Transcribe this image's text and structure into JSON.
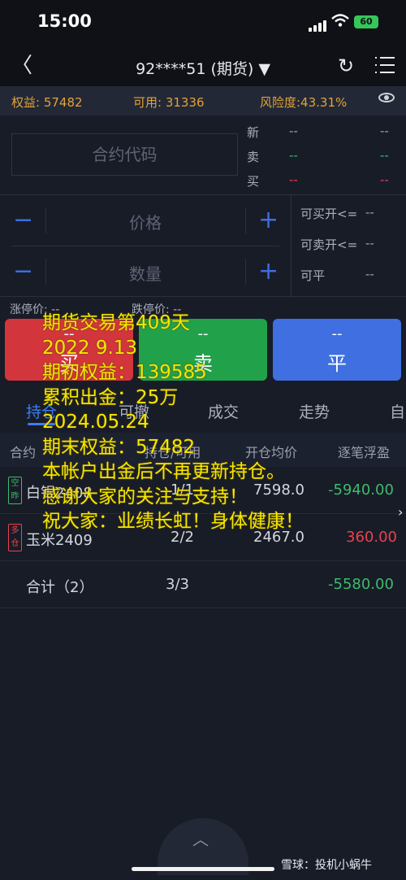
{
  "status_bar": {
    "time": "15:00",
    "battery": "60"
  },
  "nav": {
    "back": "〈",
    "title": "92****51 (期货) ▼",
    "refresh": "↻"
  },
  "account": {
    "equity_label": "权益: 57482",
    "available_label": "可用: 31336",
    "risk_label": "风险度:43.31%"
  },
  "quote": {
    "code_placeholder": "合约代码",
    "rows": [
      {
        "label": "新",
        "a": "--",
        "b": "--",
        "color": "#9aa0ad"
      },
      {
        "label": "卖",
        "a": "--",
        "b": "--",
        "color": "#3dbb6c"
      },
      {
        "label": "买",
        "a": "--",
        "b": "--",
        "color": "#e8424d"
      }
    ]
  },
  "order": {
    "price_placeholder": "价格",
    "qty_placeholder": "数量",
    "minus": "−",
    "plus": "+",
    "side_info": [
      {
        "label": "可买开<=",
        "value": "--"
      },
      {
        "label": "可卖开<=",
        "value": "--"
      },
      {
        "label": "可平",
        "value": "--"
      }
    ],
    "limit_up": "涨停价: --",
    "limit_down": "跌停价: --"
  },
  "buttons": [
    {
      "price": "--",
      "label": "买",
      "color": "#d3353c"
    },
    {
      "price": "--",
      "label": "卖",
      "color": "#21a24a"
    },
    {
      "price": "--",
      "label": "平",
      "color": "#3f6fe0"
    }
  ],
  "tabs": [
    "持仓",
    "可撤",
    "成交",
    "走势",
    "自"
  ],
  "table": {
    "headers": [
      "合约",
      "持仓/可用",
      "开仓均价",
      "逐笔浮盈"
    ],
    "rows": [
      {
        "tag": "空昨",
        "tag_color": "#3dbb6c",
        "name": "白银2408",
        "pos": "1/1",
        "avg": "7598.0",
        "pnl": "-5940.00",
        "pnl_class": "green"
      },
      {
        "tag": "多仓",
        "tag_color": "#e8424d",
        "name": "玉米2409",
        "pos": "2/2",
        "avg": "2467.0",
        "pnl": "360.00",
        "pnl_class": "red"
      }
    ],
    "total": {
      "name": "合计（2）",
      "pos": "3/3",
      "pnl": "-5580.00"
    }
  },
  "overlay_text": "期货交易第409天\n2022 9.13\n期初权益：139585\n累积出金：25万\n2024.05.24\n期末权益：57482\n本帐户出金后不再更新持仓。\n感谢大家的关注与支持！\n祝大家：业绩长虹！身体健康！",
  "watermark": "雪球：投机小蜗牛",
  "colors": {
    "background": "#181c27",
    "accent": "#3d7df0",
    "overlay": "#f6e600"
  }
}
